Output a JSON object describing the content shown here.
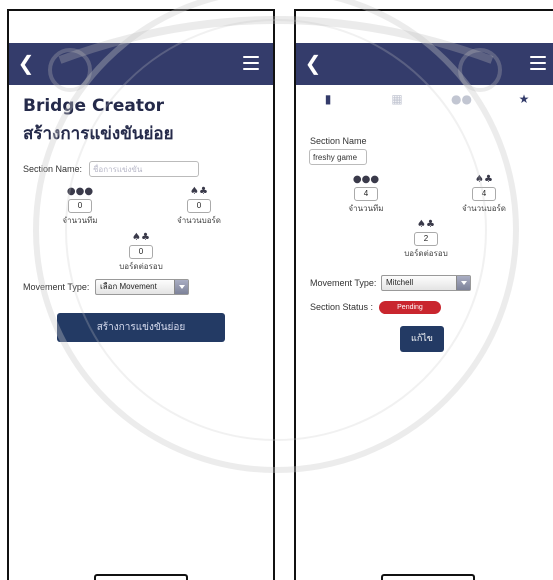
{
  "colors": {
    "navbar": "#343c6b",
    "primary_button": "#233a64",
    "status_pending": "#c9262e",
    "tab_active": "#333b6a",
    "tab_inactive": "#c2c6d2"
  },
  "left": {
    "title_en": "Bridge Creator",
    "title_th": "สร้างการแข่งขันย่อย",
    "section_name_label": "Section Name:",
    "section_name_placeholder": "ชื่อการแข่งขัน",
    "stats": [
      {
        "icon": "users-icon",
        "value": "0",
        "label": "จำนวนทีม"
      },
      {
        "icon": "cards-icon",
        "value": "0",
        "label": "จำนวนบอร์ด"
      },
      {
        "icon": "cards-icon",
        "value": "0",
        "label": "บอร์ดต่อรอบ"
      }
    ],
    "movement_label": "Movement Type:",
    "movement_value": "เลือก Movement",
    "create_button": "สร้างการแข่งขันย่อย"
  },
  "right": {
    "tabs": [
      {
        "icon": "document-icon",
        "active": true
      },
      {
        "icon": "grid-icon",
        "active": false
      },
      {
        "icon": "users-icon",
        "active": false
      },
      {
        "icon": "trophy-icon",
        "active": false
      }
    ],
    "section_name_label": "Section Name",
    "section_name_value": "freshy game",
    "stats": [
      {
        "icon": "users-icon",
        "value": "4",
        "label": "จำนวนทีม"
      },
      {
        "icon": "cards-icon",
        "value": "4",
        "label": "จำนวนบอร์ด"
      },
      {
        "icon": "cards-icon",
        "value": "2",
        "label": "บอร์ดต่อรอบ"
      }
    ],
    "movement_label": "Movement Type:",
    "movement_value": "Mitchell",
    "status_label": "Section Status :",
    "status_value": "Pending",
    "edit_button": "แก้ไข"
  }
}
